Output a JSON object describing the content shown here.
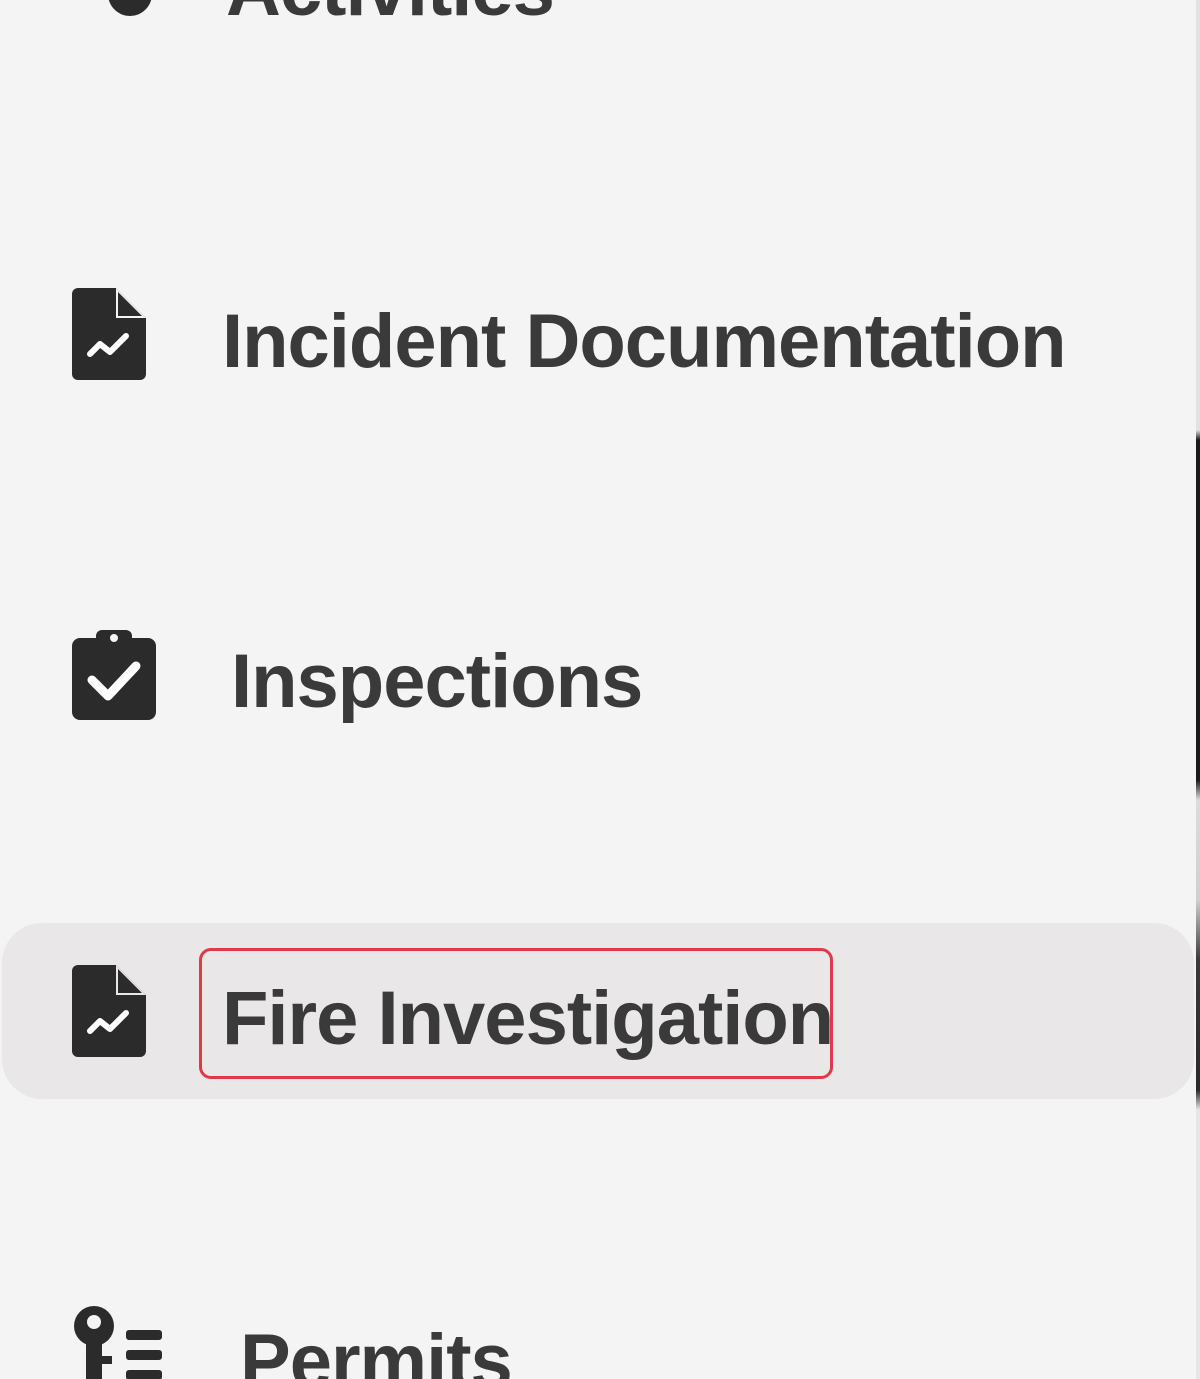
{
  "sidebar": {
    "items": [
      {
        "label": "Activities",
        "icon": "activities-icon",
        "active": false
      },
      {
        "label": "Incident Documentation",
        "icon": "file-chart-icon",
        "active": false
      },
      {
        "label": "Inspections",
        "icon": "clipboard-check-icon",
        "active": false
      },
      {
        "label": "Fire Investigation",
        "icon": "file-chart-icon",
        "active": true,
        "highlighted": true
      },
      {
        "label": "Permits",
        "icon": "key-list-icon",
        "active": false
      }
    ]
  },
  "colors": {
    "background": "#f4f4f4",
    "active_background": "#e9e7e8",
    "text": "#3a3a3a",
    "icon": "#2b2b2b",
    "highlight_border": "#e03a4a"
  }
}
